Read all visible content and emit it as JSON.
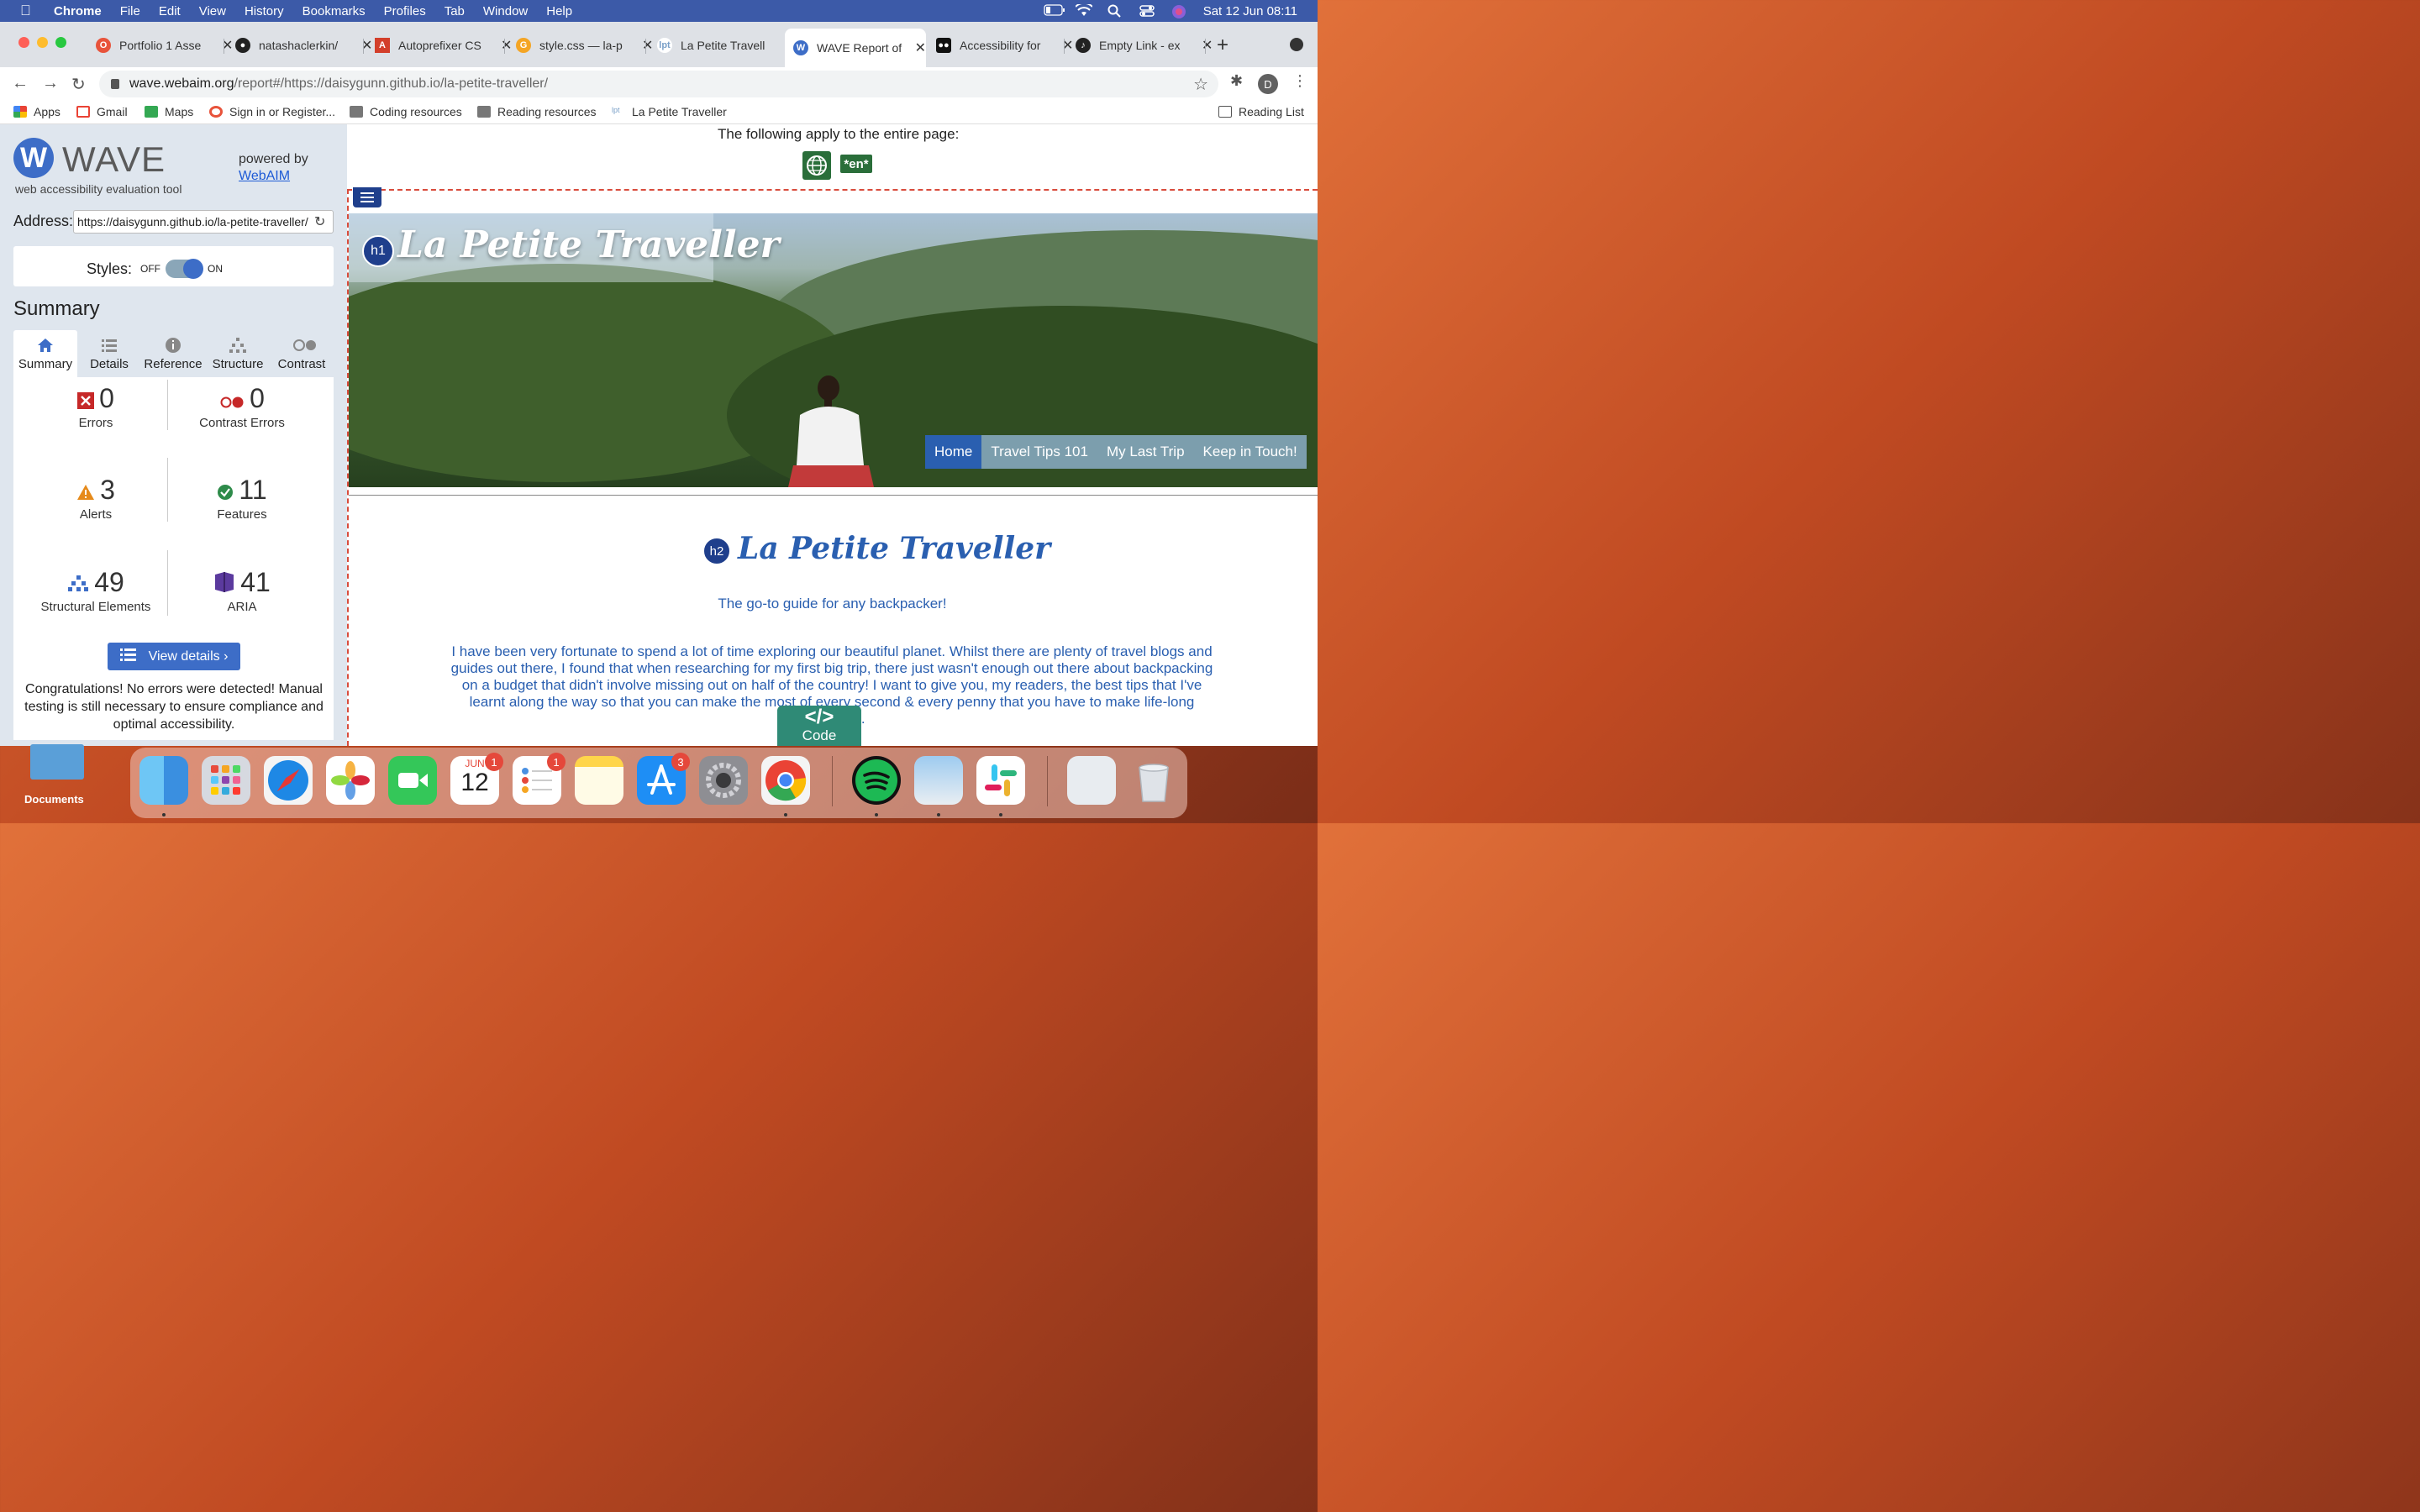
{
  "menubar": {
    "app": "Chrome",
    "items": [
      "File",
      "Edit",
      "View",
      "History",
      "Bookmarks",
      "Profiles",
      "Tab",
      "Window",
      "Help"
    ],
    "clock": "Sat 12 Jun  08:11"
  },
  "tabs": [
    {
      "title": "Portfolio 1 Asse",
      "color": "#e8533b"
    },
    {
      "title": "natashaclerkin/",
      "color": "#222222"
    },
    {
      "title": "Autoprefixer CS",
      "color": "#d33f2b"
    },
    {
      "title": "style.css — la-p",
      "color": "#f4a525"
    },
    {
      "title": "La Petite Travell",
      "color": "#7aa0c8"
    },
    {
      "title": "WAVE Report of",
      "color": "#3d6dc7"
    },
    {
      "title": "Accessibility for",
      "color": "#111111"
    },
    {
      "title": "Empty Link - ex",
      "color": "#222222"
    }
  ],
  "omnibox": {
    "host": "wave.webaim.org",
    "path": "/report#/https://daisygunn.github.io/la-petite-traveller/"
  },
  "bookmarks": {
    "items": [
      "Apps",
      "Gmail",
      "Maps",
      "Sign in or Register...",
      "Coding resources",
      "Reading resources",
      "La Petite Traveller"
    ],
    "reading_list": "Reading List"
  },
  "wave": {
    "logo_letter": "W",
    "title": "WAVE",
    "subtitle": "web accessibility evaluation tool",
    "powered_by": "powered by",
    "webaim": "WebAIM",
    "address_label": "Address:",
    "address_value": "https://daisygunn.github.io/la-petite-traveller/",
    "styles_label": "Styles:",
    "off": "OFF",
    "on": "ON",
    "summary_heading": "Summary",
    "tabs": [
      "Summary",
      "Details",
      "Reference",
      "Structure",
      "Contrast"
    ],
    "stats": {
      "errors": {
        "value": "0",
        "label": "Errors"
      },
      "contrast_errors": {
        "value": "0",
        "label": "Contrast Errors"
      },
      "alerts": {
        "value": "3",
        "label": "Alerts"
      },
      "features": {
        "value": "11",
        "label": "Features"
      },
      "structural": {
        "value": "49",
        "label": "Structural Elements"
      },
      "aria": {
        "value": "41",
        "label": "ARIA"
      }
    },
    "view_details": "View details ›",
    "congrats": "Congratulations! No errors were detected! Manual testing is still necessary to ensure compliance and optimal accessibility."
  },
  "page": {
    "apply_text": "The following apply to the entire page:",
    "lang_badge": "*en*",
    "h1_badge": "h1",
    "hero_title": "La Petite Traveller",
    "nav": [
      "Home",
      "Travel Tips 101",
      "My Last Trip",
      "Keep in Touch!"
    ],
    "h2_badge": "h2",
    "h2_title": "La Petite Traveller",
    "tagline": "The go-to guide for any backpacker!",
    "intro": "I have been very fortunate to spend a lot of time exploring our beautiful planet. Whilst there are plenty of travel blogs and guides out there, I found that when researching for my first big trip, there just wasn't enough out there about backpacking on a budget that didn't involve missing out on half of the country! I want to give you, my readers, the best tips that I've learnt along the way so that you can make the most of every second & every penny that you have to make life-long memories.",
    "code_icon": "</>",
    "code_label": "Code"
  },
  "desktop": {
    "folder_label": "Documents"
  },
  "dock": {
    "calendar_month": "JUN",
    "calendar_day": "12",
    "calendar_badge": "1",
    "reminders_badge": "1",
    "appstore_badge": "3"
  }
}
